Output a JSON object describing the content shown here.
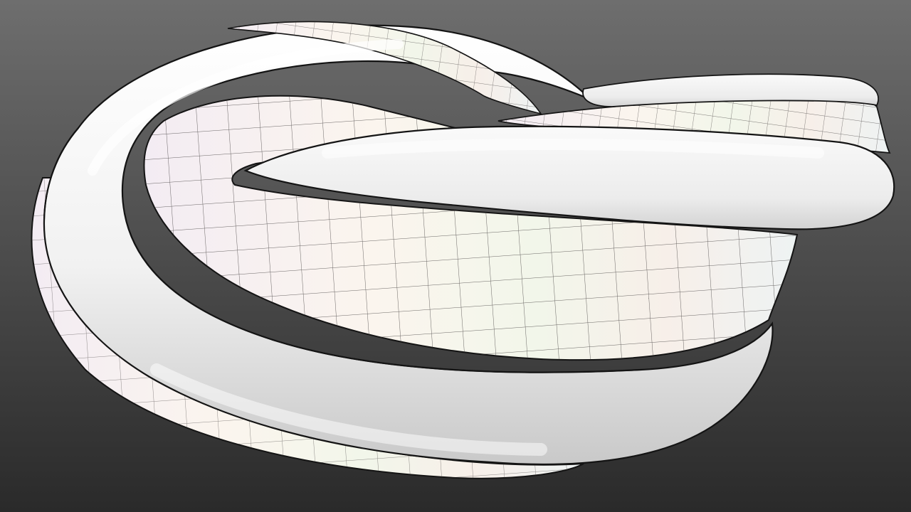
{
  "scene": {
    "subject": "twisted-ribbon-surface",
    "colors": {
      "background_top": "#6e6e6e",
      "background_bottom": "#2a2a2a",
      "tube": "#f4f4f4",
      "tube_shadow": "#bdbdbd",
      "outline": "#141414",
      "band": "#fbf7f2",
      "grid": "#3a3636"
    }
  }
}
